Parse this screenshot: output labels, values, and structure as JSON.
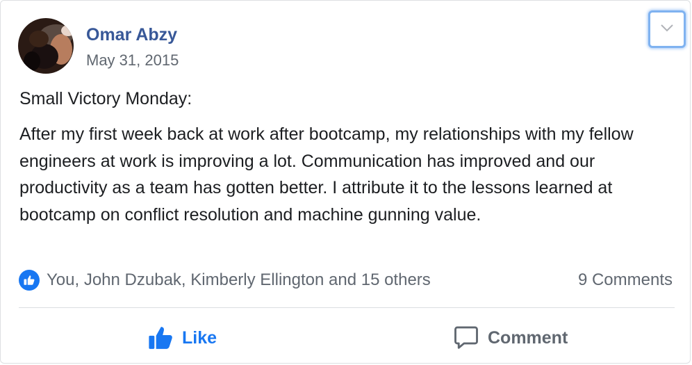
{
  "post": {
    "author": "Omar Abzy",
    "date": "May 31, 2015",
    "title": "Small Victory Monday:",
    "body": "After my first week back at work after bootcamp, my relationships with my fellow engineers at work is improving a lot. Communication has improved and our productivity as a team has gotten better. I attribute it to the lessons learned at bootcamp on conflict resolution and machine gunning value."
  },
  "reactions": {
    "icon": "thumbs-up-icon",
    "summary": "You, John Dzubak, Kimberly Ellington and 15 others",
    "comments": "9 Comments"
  },
  "actions": {
    "like_label": "Like",
    "like_icon": "thumbs-up-icon",
    "comment_label": "Comment",
    "comment_icon": "speech-bubble-icon"
  },
  "menu": {
    "icon": "chevron-down-icon"
  },
  "colors": {
    "author": "#385898",
    "accent": "#1877f2",
    "muted": "#606770",
    "text": "#1c1e21"
  }
}
